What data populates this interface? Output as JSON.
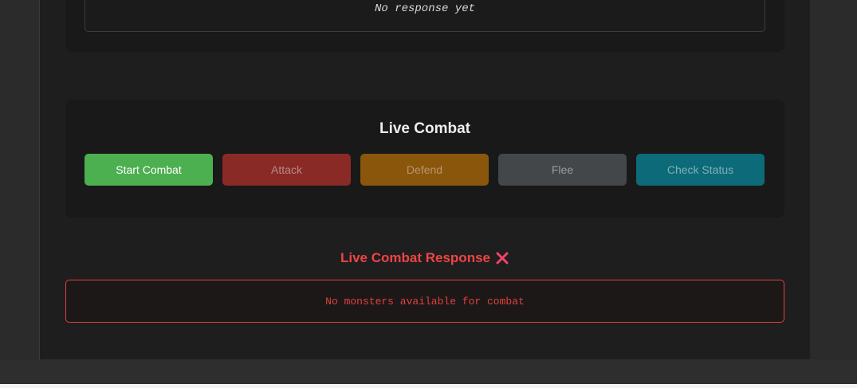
{
  "previous_response": {
    "text": "No response yet"
  },
  "combat": {
    "title": "Live Combat",
    "buttons": {
      "start": "Start Combat",
      "attack": "Attack",
      "defend": "Defend",
      "flee": "Flee",
      "status": "Check Status"
    }
  },
  "live_response": {
    "heading": "Live Combat Response",
    "status_icon": "cross-mark-icon",
    "message": "No monsters available for combat"
  },
  "colors": {
    "start_button": "#4caf50",
    "attack_button": "#8a2a26",
    "defend_button": "#8a560c",
    "flee_button": "#43474a",
    "status_button": "#0d6a78",
    "error": "#ef4444"
  }
}
